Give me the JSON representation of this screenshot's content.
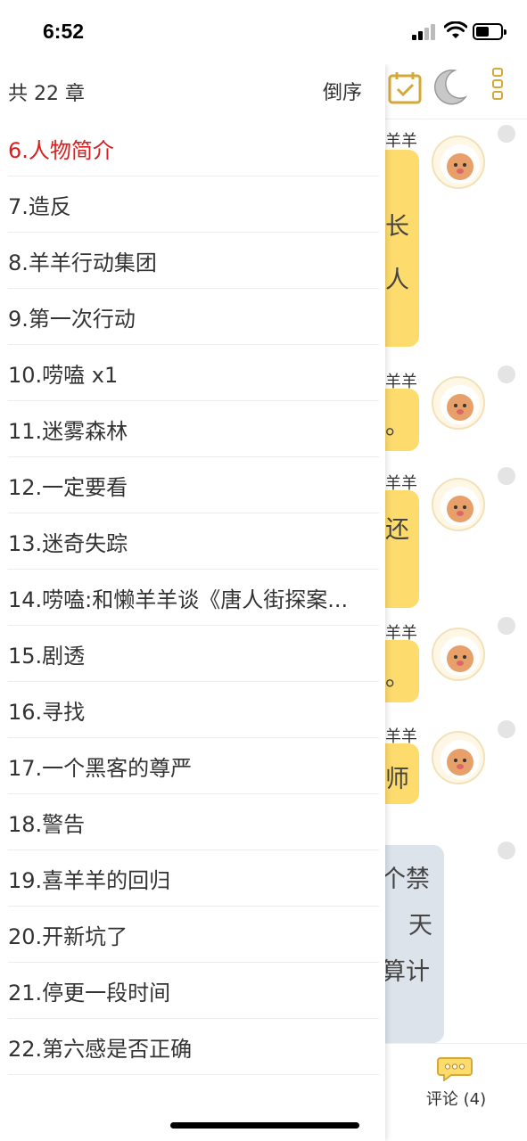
{
  "status_bar": {
    "time": "6:52"
  },
  "drawer": {
    "chapter_count": "共 22 章",
    "sort_label": "倒序",
    "chapters": [
      {
        "label": "6.人物简介",
        "active": true
      },
      {
        "label": "7.造反"
      },
      {
        "label": "8.羊羊行动集团"
      },
      {
        "label": "9.第一次行动"
      },
      {
        "label": "10.唠嗑 x1"
      },
      {
        "label": "11.迷雾森林"
      },
      {
        "label": "12.一定要看"
      },
      {
        "label": "13.迷奇失踪"
      },
      {
        "label": "14.唠嗑:和懒羊羊谈《唐人街探案..."
      },
      {
        "label": "15.剧透"
      },
      {
        "label": "16.寻找"
      },
      {
        "label": "17.一个黑客的尊严"
      },
      {
        "label": "18.警告"
      },
      {
        "label": "19.喜羊羊的回归"
      },
      {
        "label": "20.开新坑了"
      },
      {
        "label": "21.停更一段时间"
      },
      {
        "label": "22.第六感是否正确"
      }
    ]
  },
  "chat": {
    "messages": [
      {
        "name": "羊羊",
        "lines": [
          "长",
          "人"
        ]
      },
      {
        "name": "羊羊",
        "lines": [
          "。"
        ]
      },
      {
        "name": "羊羊",
        "lines": [
          "还"
        ]
      },
      {
        "name": "羊羊",
        "lines": [
          "。"
        ]
      },
      {
        "name": "羊羊",
        "lines": [
          "师"
        ]
      },
      {
        "name": "",
        "lines": [
          "个禁",
          "天",
          "算计"
        ]
      }
    ],
    "comment_label": "评论 (4)"
  },
  "colors": {
    "accent_active": "#d81e1e",
    "bubble_yellow": "#fddb6d",
    "bubble_blue": "#dde3ea",
    "icon_gold": "#d4a93a"
  }
}
